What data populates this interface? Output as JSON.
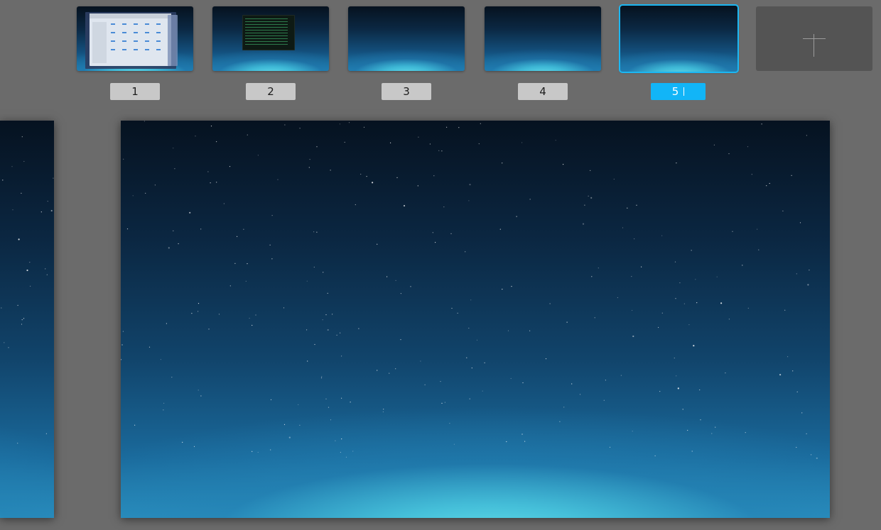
{
  "workspaces": [
    {
      "label": "1",
      "content": "windows"
    },
    {
      "label": "2",
      "content": "terminal"
    },
    {
      "label": "3",
      "content": "empty"
    },
    {
      "label": "4",
      "content": "empty"
    },
    {
      "label": "5",
      "content": "empty",
      "selected": true
    }
  ],
  "add_button": {
    "icon": "plus-icon"
  },
  "colors": {
    "background": "#6b6b6b",
    "accent": "#12b5f7",
    "label_bg": "#c8c8c8",
    "add_bg": "#545454"
  }
}
